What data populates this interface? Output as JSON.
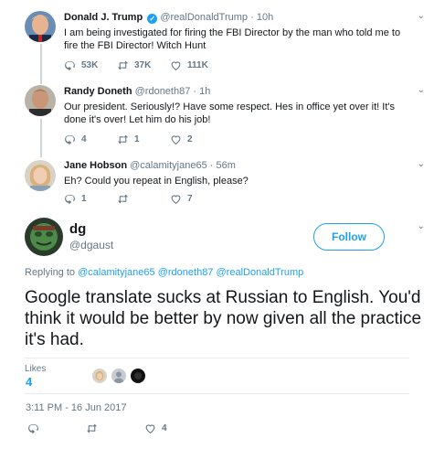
{
  "tweets": [
    {
      "name": "Donald J. Trump",
      "handle": "@realDonaldTrump",
      "dot": "·",
      "time": "10h",
      "text": "I am being investigated for firing the FBI Director by the man who told me to fire the FBI Director! Witch Hunt",
      "reply_count": "53K",
      "retweet_count": "37K",
      "like_count": "111K"
    },
    {
      "name": "Randy Doneth",
      "handle": "@rdoneth87",
      "dot": "·",
      "time": "1h",
      "text": "Our president. Seriously!? Have some respect. Hes in office yet over it! It's done it's over! Let him do his job!",
      "reply_count": "4",
      "retweet_count": "1",
      "like_count": "2"
    },
    {
      "name": "Jane Hobson",
      "handle": "@calamityjane65",
      "dot": "·",
      "time": "56m",
      "text": "Eh? Could you repeat in English, please?",
      "reply_count": "1",
      "retweet_count": "",
      "like_count": "7"
    }
  ],
  "main_tweet": {
    "name": "dg",
    "handle": "@dgaust",
    "follow_label": "Follow",
    "replying_prefix": "Replying to",
    "mentions": [
      "@calamityjane65",
      "@rdoneth87",
      "@realDonaldTrump"
    ],
    "text": "Google translate sucks at Russian to English. You'd think it would be better by now given all the practice it's had.",
    "likes_label": "Likes",
    "likes_count": "4",
    "timestamp": "3:11 PM - 16 Jun 2017",
    "bottom_like_count": "4"
  },
  "colors": {
    "accent": "#1da1f2",
    "secondary_text": "#657786",
    "border": "#e6ecf0"
  },
  "icons": {
    "reply": "reply-icon",
    "retweet": "retweet-icon",
    "like": "heart-icon",
    "verified": "verified-badge-icon",
    "menu": "chevron-down-icon"
  }
}
